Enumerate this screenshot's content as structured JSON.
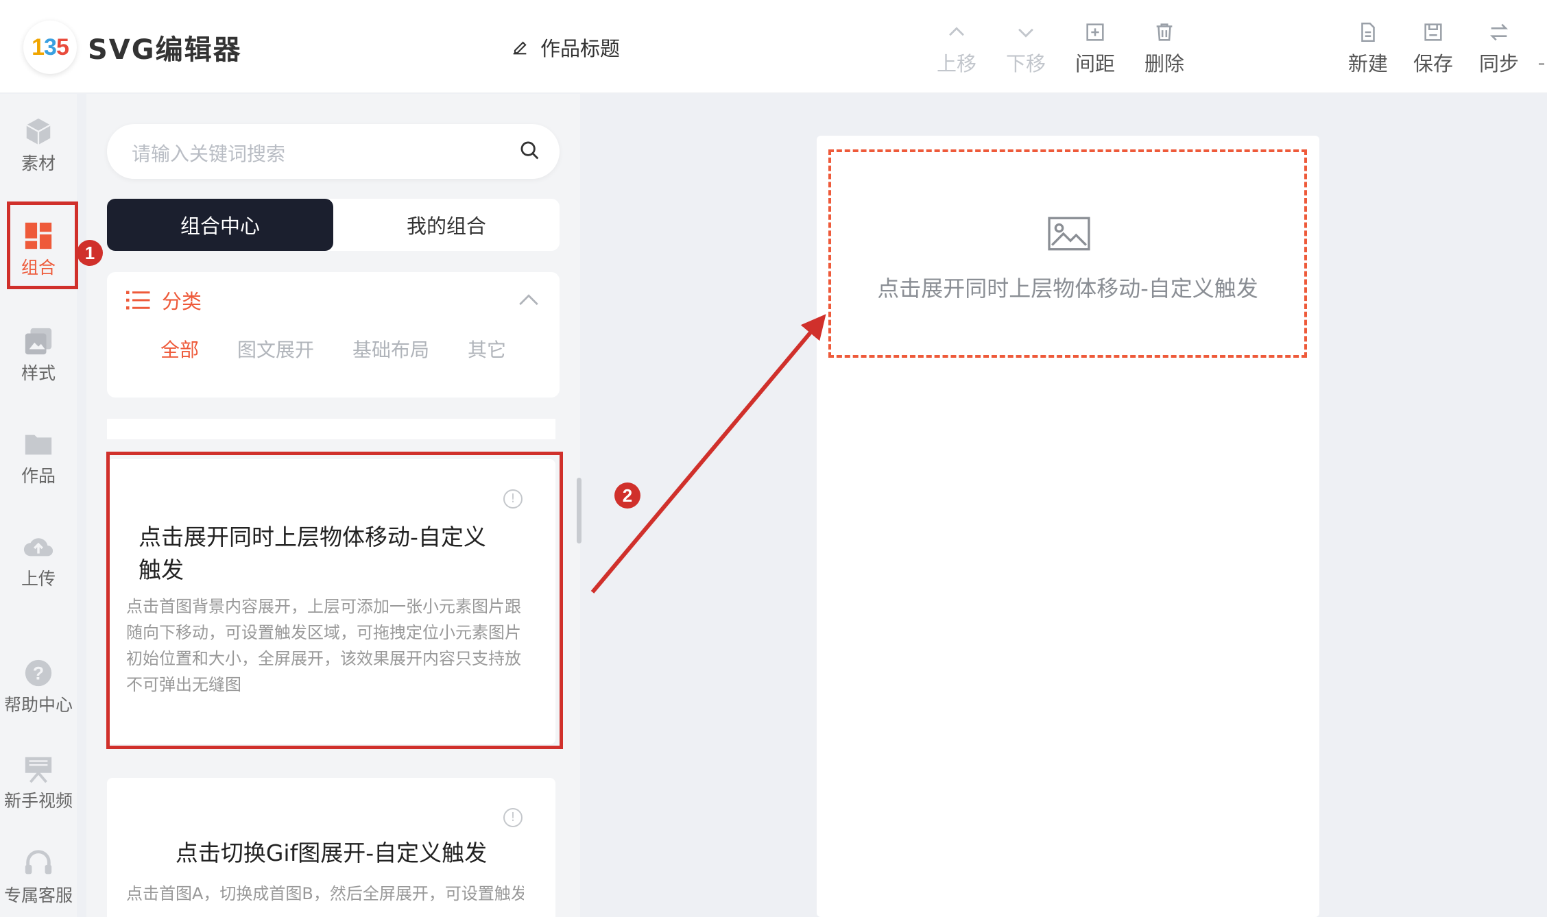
{
  "header": {
    "app_title": "SVG编辑器",
    "doc_title": "作品标题",
    "toolbar": [
      {
        "label": "上移",
        "icon": "chevron-up-icon",
        "enabled": false
      },
      {
        "label": "下移",
        "icon": "chevron-down-icon",
        "enabled": false
      },
      {
        "label": "间距",
        "icon": "add-spacing-icon",
        "enabled": true
      },
      {
        "label": "删除",
        "icon": "trash-icon",
        "enabled": true
      }
    ],
    "actions": [
      {
        "label": "新建",
        "icon": "new-file-icon"
      },
      {
        "label": "保存",
        "icon": "save-icon"
      },
      {
        "label": "同步",
        "icon": "sync-icon"
      }
    ]
  },
  "nav": {
    "items": [
      {
        "label": "素材",
        "icon": "cube-icon"
      },
      {
        "label": "组合",
        "icon": "layout-icon",
        "active": true
      },
      {
        "label": "样式",
        "icon": "style-icon"
      },
      {
        "label": "作品",
        "icon": "folder-icon"
      },
      {
        "label": "上传",
        "icon": "cloud-upload-icon"
      },
      {
        "label": "帮助中心",
        "icon": "help-icon"
      },
      {
        "label": "新手视频",
        "icon": "video-icon"
      },
      {
        "label": "专属客服",
        "icon": "headset-icon"
      }
    ]
  },
  "panel": {
    "search_placeholder": "请输入关键词搜索",
    "tabs": [
      {
        "label": "组合中心",
        "active": true
      },
      {
        "label": "我的组合",
        "active": false
      }
    ],
    "category": {
      "title": "分类",
      "options": [
        {
          "label": "全部",
          "active": true
        },
        {
          "label": "图文展开",
          "active": false
        },
        {
          "label": "基础布局",
          "active": false
        },
        {
          "label": "其它",
          "active": false
        }
      ]
    },
    "cards": [
      {
        "title": "点击展开同时上层物体移动-自定义触发",
        "description": "点击首图背景内容展开，上层可添加一张小元素图片跟随向下移动，可设置触发区域，可拖拽定位小元素图片初始位置和大小，全屏展开，该效果展开内容只支持放不可弹出无缝图"
      },
      {
        "title": "点击切换Gif图展开-自定义触发",
        "description": "点击首图A，切换成首图B，然后全屏展开，可设置触发区域，如果B为gif图，则可从第一帧开始播放，首"
      }
    ]
  },
  "canvas": {
    "placeholder_text": "点击展开同时上层物体移动-自定义触发"
  },
  "annotations": {
    "step1": "1",
    "step2": "2",
    "color": "#d0302b"
  },
  "colors": {
    "accent": "#ee5a3a",
    "dark_tab": "#1b1f2e",
    "annotation_red": "#d0302b"
  }
}
